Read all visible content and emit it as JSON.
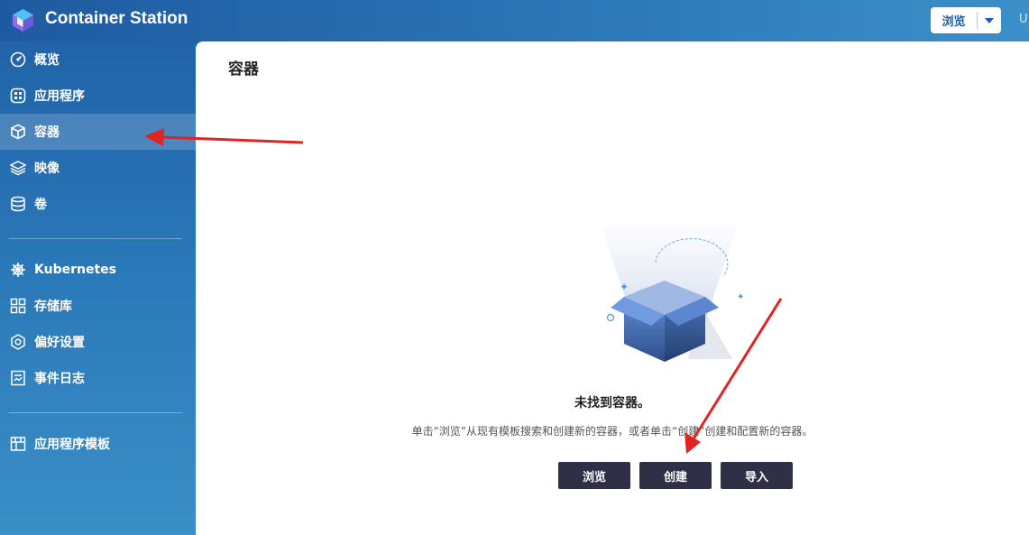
{
  "header": {
    "app_title": "Container Station",
    "browse_button": "浏览",
    "user_partial": "U"
  },
  "sidebar": {
    "items": [
      {
        "label": "概览",
        "icon": "dashboard-icon"
      },
      {
        "label": "应用程序",
        "icon": "apps-icon"
      },
      {
        "label": "容器",
        "icon": "cube-icon",
        "active": true
      },
      {
        "label": "映像",
        "icon": "layers-icon"
      },
      {
        "label": "卷",
        "icon": "database-icon"
      },
      {
        "label": "Kubernetes",
        "icon": "helm-icon"
      },
      {
        "label": "存储库",
        "icon": "registry-icon"
      },
      {
        "label": "偏好设置",
        "icon": "settings-icon"
      },
      {
        "label": "事件日志",
        "icon": "log-icon"
      },
      {
        "label": "应用程序模板",
        "icon": "template-icon"
      }
    ]
  },
  "main": {
    "title": "容器",
    "empty_title": "未找到容器。",
    "empty_desc": "单击“浏览”从现有模板搜索和创建新的容器，或者单击“创建”创建和配置新的容器。",
    "buttons": [
      "浏览",
      "创建",
      "导入"
    ]
  },
  "colors": {
    "accent": "#2a73b4",
    "button_dark": "#2f2f47",
    "annotation_arrow": "#e02424"
  }
}
